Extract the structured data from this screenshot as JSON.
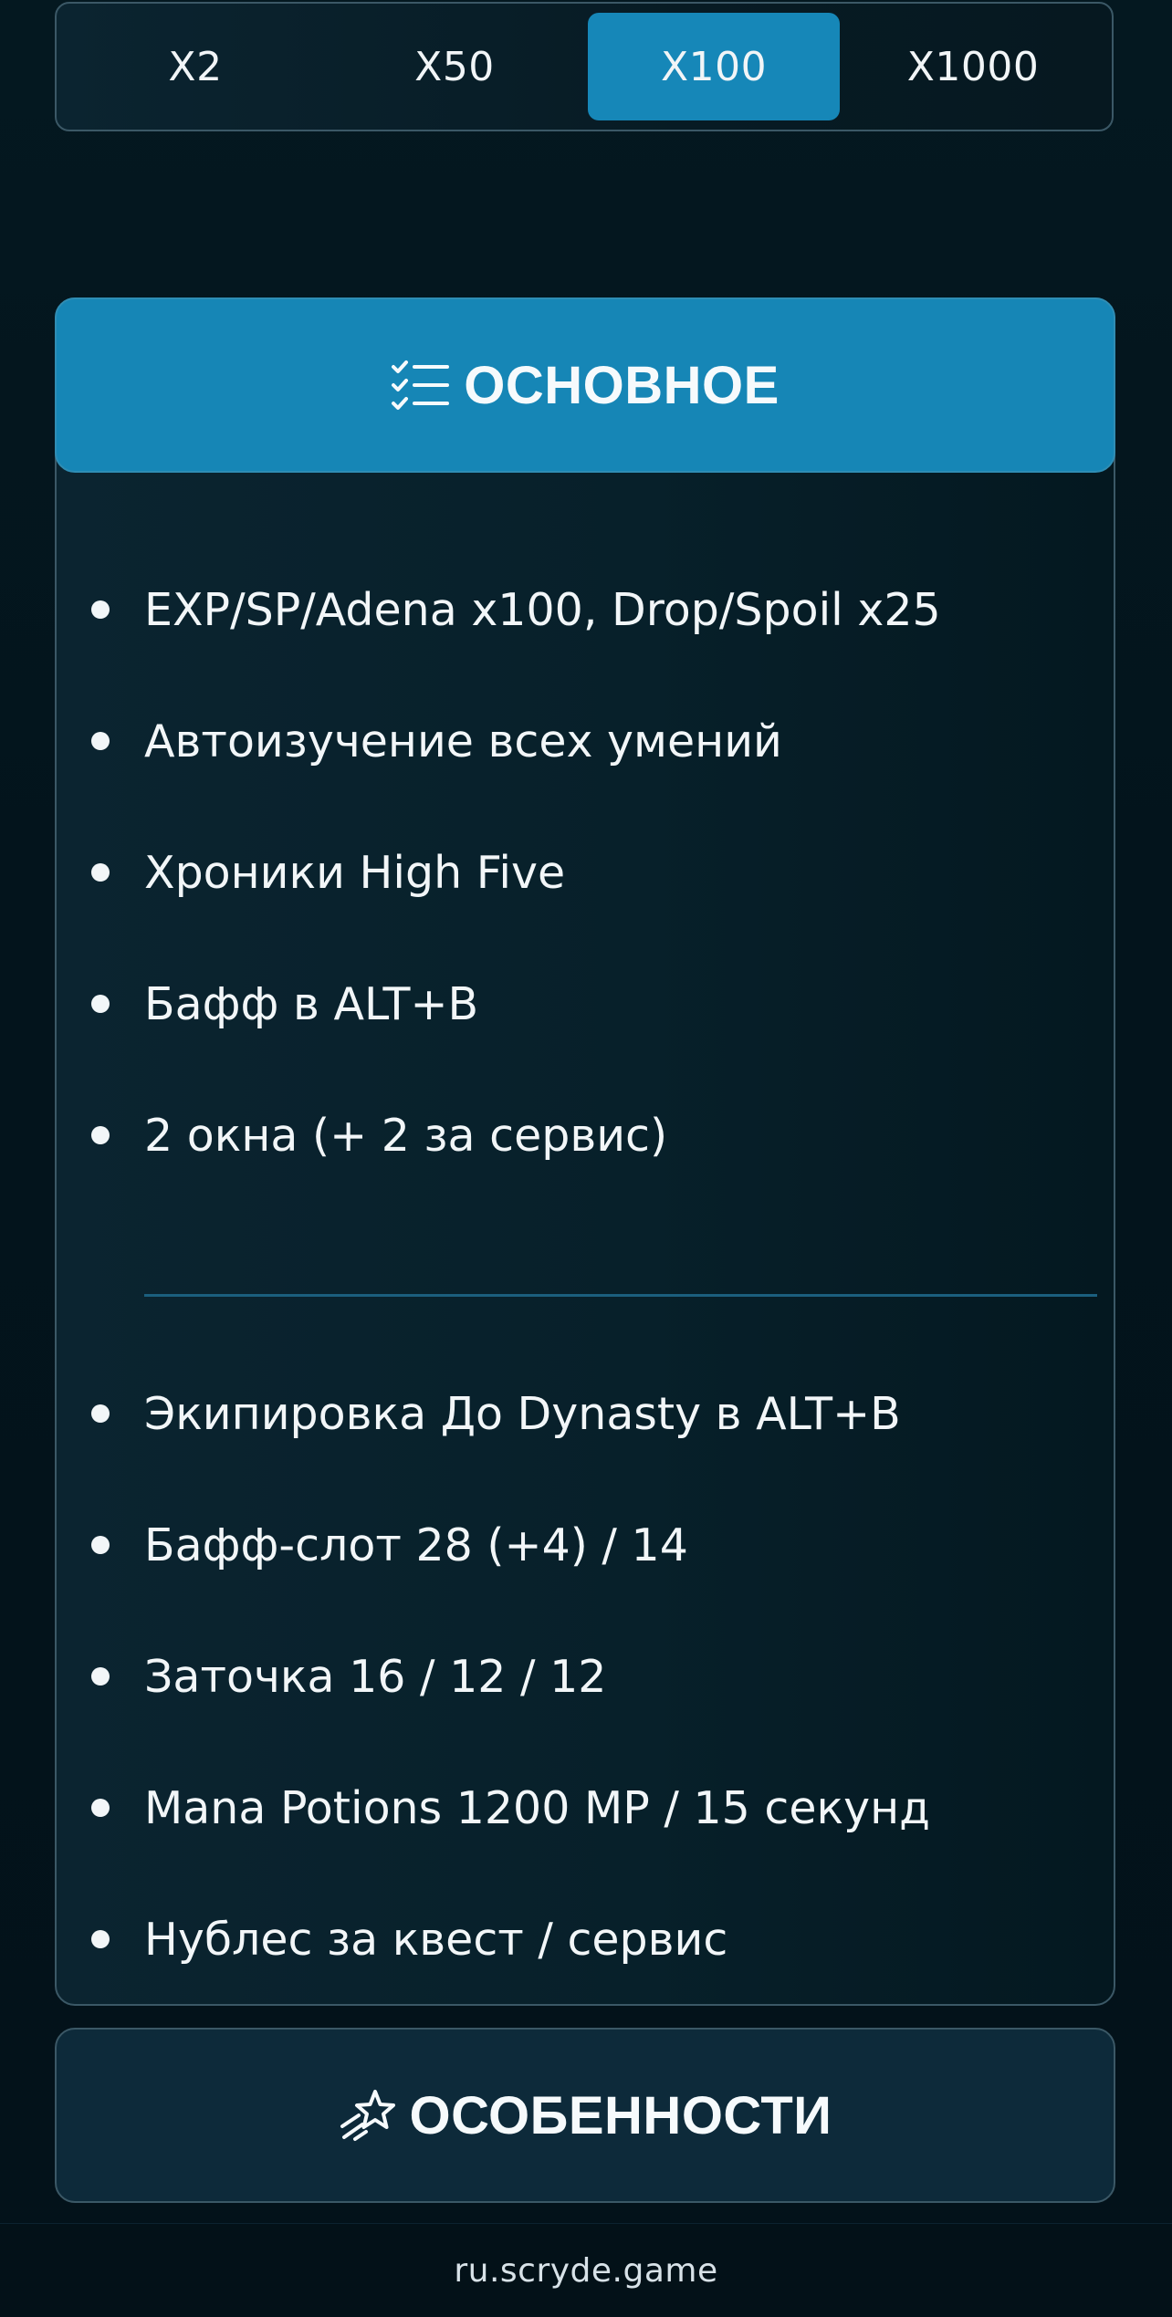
{
  "rates": {
    "tabs": [
      {
        "label": "X2",
        "active": false
      },
      {
        "label": "X50",
        "active": false
      },
      {
        "label": "X100",
        "active": true
      },
      {
        "label": "X1000",
        "active": false
      }
    ]
  },
  "main_section": {
    "icon": "checklist-icon",
    "title": "ОСНОВНОЕ",
    "group1": [
      "EXP/SP/Adena x100, Drop/Spoil x25",
      "Автоизучение всех умений",
      "Хроники High Five",
      "Бафф в ALT+B",
      "2 окна (+ 2 за сервис)"
    ],
    "group2": [
      "Экипировка До Dynasty в ALT+B",
      "Бафф-слот 28 (+4) / 14",
      "Заточка 16 / 12 / 12",
      "Mana Potions 1200 MP / 15 секунд",
      "Нублес за квест / сервис"
    ]
  },
  "features_section": {
    "icon": "shooting-star-icon",
    "title": "ОСОБЕННОСТИ"
  },
  "footer": {
    "domain": "ru.scryde.game"
  },
  "colors": {
    "accent": "#1686b6",
    "background": "#03121a",
    "card_border": "#3b5866",
    "divider": "#1b5f7e"
  }
}
